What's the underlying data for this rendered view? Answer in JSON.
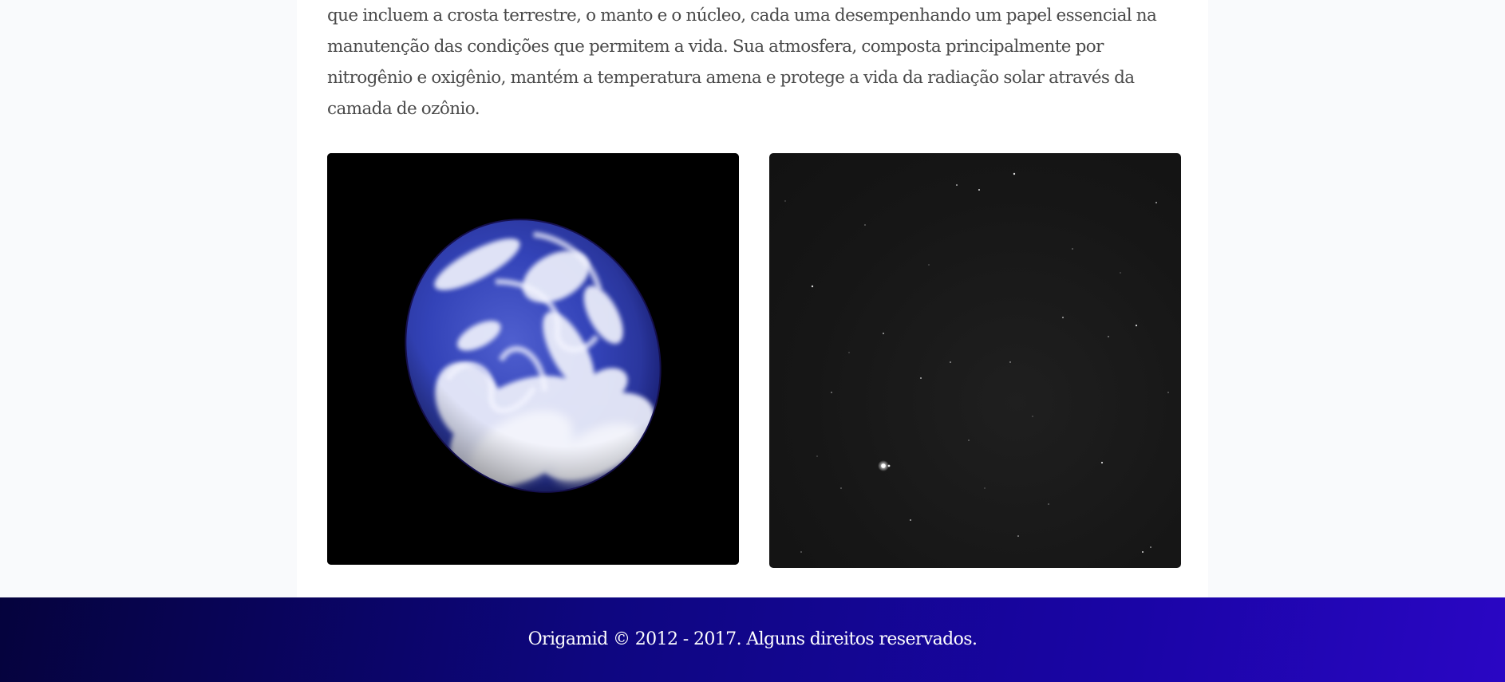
{
  "article": {
    "lines": [
      "que incluem a crosta terrestre, o manto e o núcleo, cada uma desempenhando um papel essencial na",
      "manutenção das condições que permitem a vida. Sua atmosfera, composta principalmente por",
      "nitrogênio e oxigênio, mantém a temperatura amena e protege a vida da radiação solar através da",
      "camada de ozônio."
    ]
  },
  "gallery": {
    "images": [
      {
        "subject": "earth-globe-photo"
      },
      {
        "subject": "starfield-photo"
      }
    ]
  },
  "footer": {
    "text": "Origamid © 2012 - 2017. Alguns direitos reservados."
  },
  "colors": {
    "body_text": "#4a4a4a",
    "page_background": "#f9fafc",
    "content_background": "#ffffff",
    "footer_gradient_start": "#05033d",
    "footer_gradient_end": "#2a06c4",
    "footer_text": "#ffffff"
  }
}
